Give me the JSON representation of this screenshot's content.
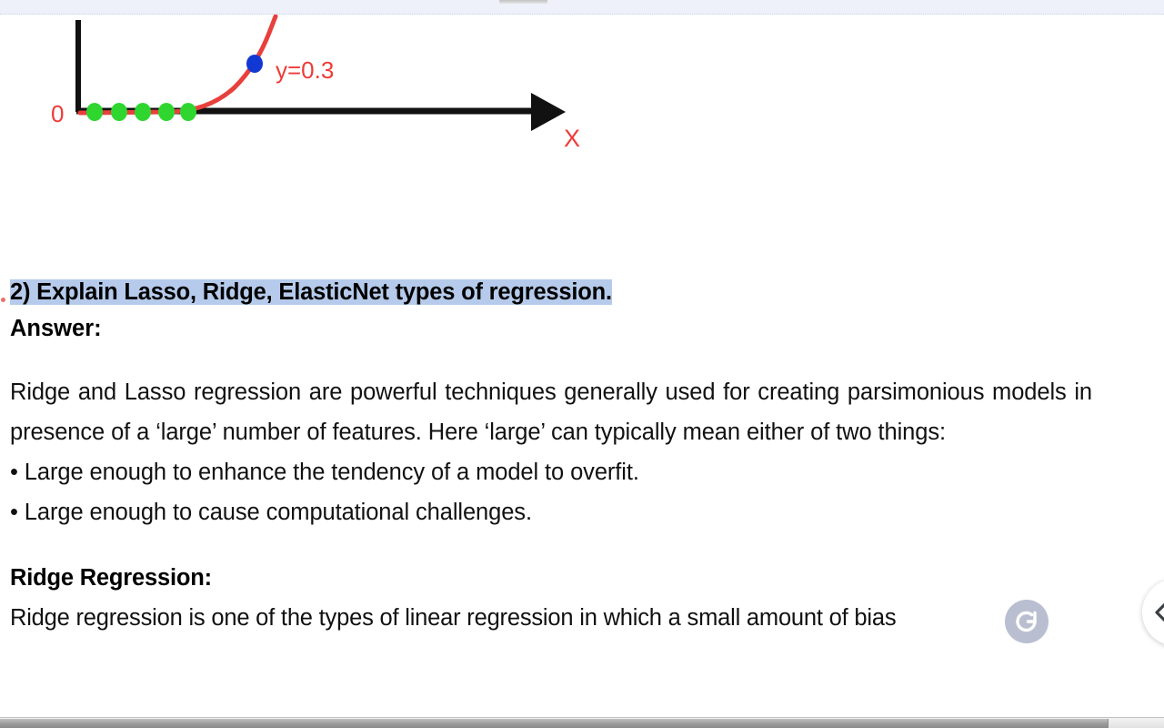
{
  "top_bar": {
    "handle_name": "toolbar-drag-handle"
  },
  "figure": {
    "axis_origin_label": "0",
    "x_axis_label": "X",
    "curve_label": "y=0.3",
    "icons": {
      "x_axis_arrow": "arrow-right-icon"
    },
    "colors": {
      "axis": "#111111",
      "curve": "#e8403c",
      "label_red": "#ef3b38",
      "point_green": "#2fd62f",
      "point_blue": "#1238d4"
    }
  },
  "chart_data": {
    "type": "line",
    "title": "",
    "xlabel": "X",
    "ylabel": "",
    "series": [
      {
        "name": "exponential curve",
        "x": [
          210,
          225,
          240,
          252,
          263,
          272,
          281,
          290,
          298,
          305
        ],
        "y": [
          0,
          2,
          7,
          15,
          25,
          37,
          50,
          66,
          85,
          106
        ]
      }
    ],
    "points": {
      "green_points_on_axis": [
        {
          "x": 104,
          "y": 0
        },
        {
          "x": 131,
          "y": 0
        },
        {
          "x": 157,
          "y": 0
        },
        {
          "x": 183,
          "y": 0
        },
        {
          "x": 207,
          "y": 0
        }
      ],
      "blue_point": {
        "x": 281,
        "y": 54,
        "label": "y=0.3"
      }
    },
    "grid": false,
    "legend": "none",
    "annotations": [
      "y=0.3",
      "0",
      "X"
    ]
  },
  "content": {
    "question_heading": "2) Explain Lasso, Ridge, ElasticNet types of regression.",
    "answer_label": "Answer:",
    "paragraph": "Ridge and Lasso regression are powerful techniques generally used for creating parsimonious models in presence of a ‘large’ number of features. Here ‘large’ can typically mean either of two things:",
    "bullets": [
      "• Large enough to enhance the tendency of a model to overfit.",
      "• Large enough to cause computational challenges."
    ],
    "sub_heading": "Ridge Regression:",
    "tail_line": "Ridge regression is one of the types of linear regression in which a small amount of bias",
    "highlight_color": "#b6cbeb"
  },
  "controls": {
    "rotate_badge": {
      "icon": "rotate-left-icon",
      "color": "#b9bfd0"
    },
    "edge_nav": {
      "icon": "chevron-left-icon",
      "label": ""
    },
    "scrollbar": {
      "orientation": "horizontal"
    }
  }
}
